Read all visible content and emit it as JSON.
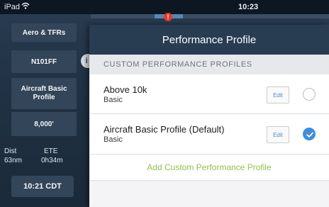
{
  "status_bar": {
    "device": "iPad",
    "wifi_icon": "wifi-icon",
    "time": "10:23"
  },
  "notification": {
    "badge": "!"
  },
  "sidebar": {
    "aero_tfrs": "Aero & TFRs",
    "tail": "N101FF",
    "profile_line1": "Aircraft Basic",
    "profile_line2": "Profile",
    "altitude": "8,000'",
    "dist_label": "Dist",
    "dist_value": "63nm",
    "ete_label": "ETE",
    "ete_value": "0h34m",
    "clock": "10:21 CDT"
  },
  "panel": {
    "title": "Performance Profile",
    "section_header": "CUSTOM PERFORMANCE PROFILES",
    "profiles": [
      {
        "name": "Above 10k",
        "type": "Basic",
        "edit_label": "Edit",
        "selected": false
      },
      {
        "name": "Aircraft Basic Profile (Default)",
        "type": "Basic",
        "edit_label": "Edit",
        "selected": true
      }
    ],
    "add_label": "Add Custom Performance Profile"
  },
  "colors": {
    "accent_blue": "#3c8ee0",
    "add_green": "#8ec24a",
    "header_navy": "#283c52",
    "alert_red": "#e03b2b"
  }
}
